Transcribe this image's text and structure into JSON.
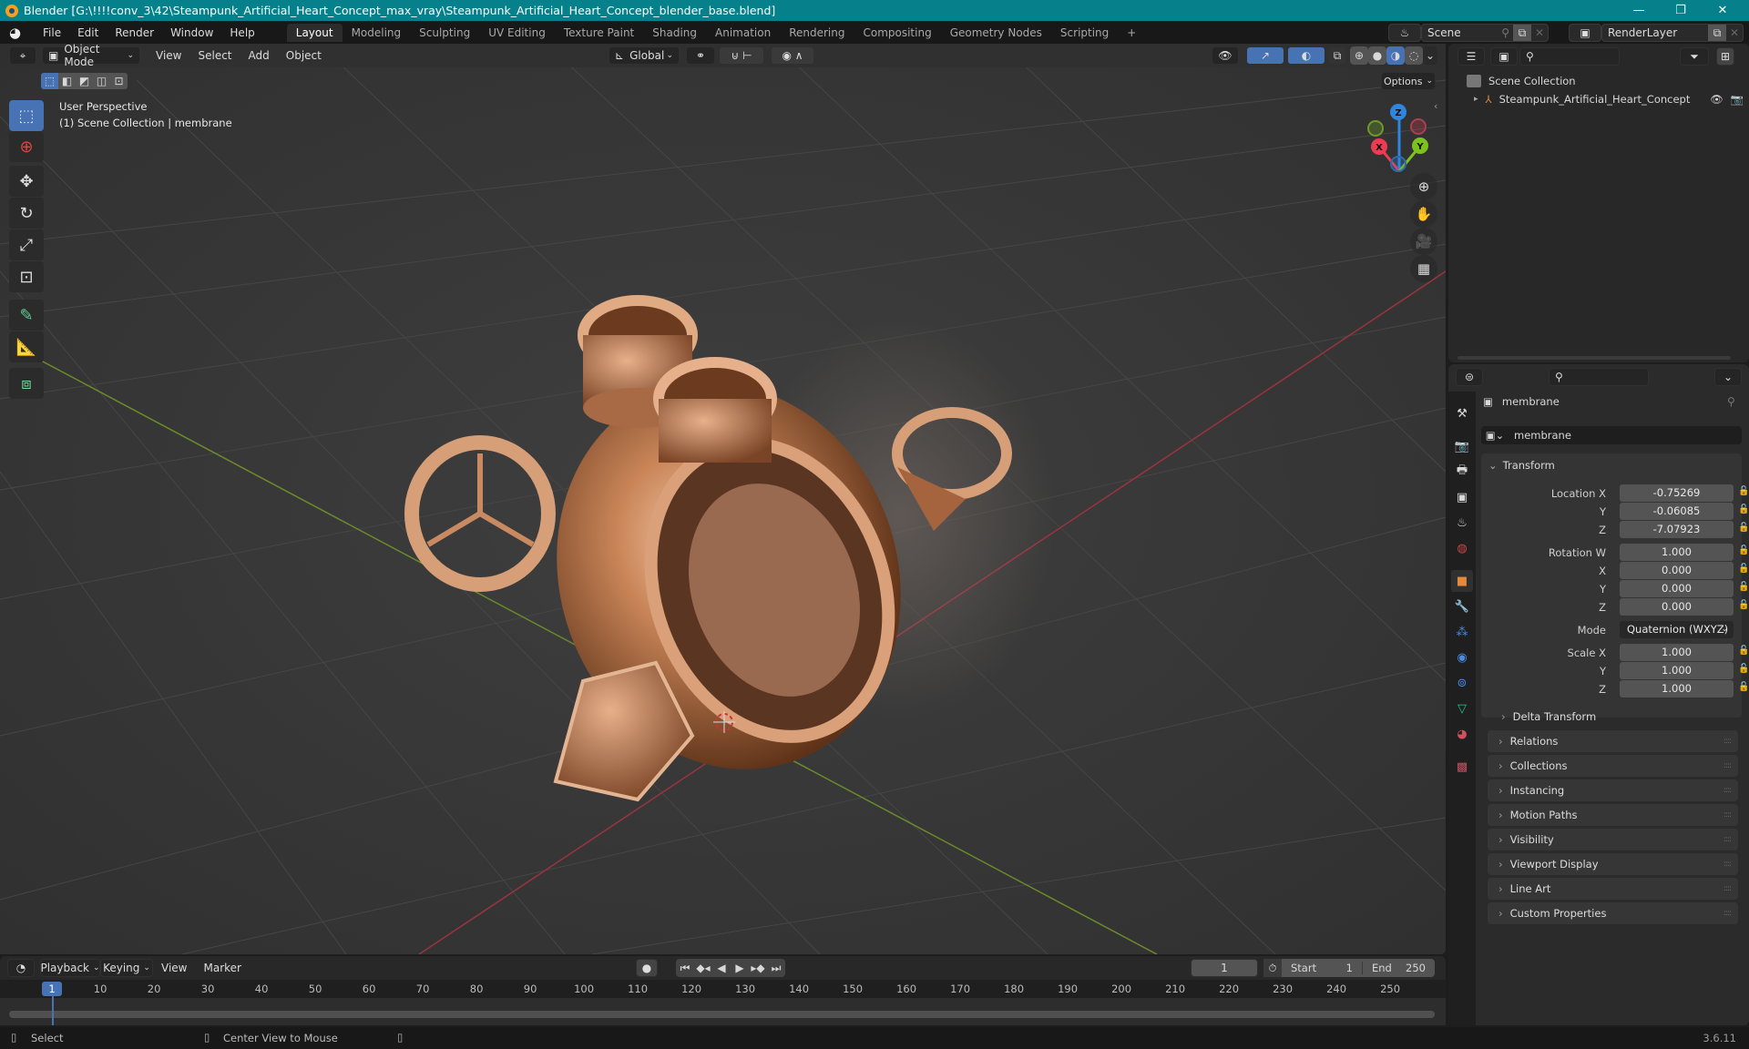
{
  "titlebar": {
    "title": "Blender [G:\\!!!!conv_3\\42\\Steampunk_Artificial_Heart_Concept_max_vray\\Steampunk_Artificial_Heart_Concept_blender_base.blend]",
    "minimize": "—",
    "maximize": "❐",
    "close": "✕"
  },
  "menubar": {
    "menus": [
      "File",
      "Edit",
      "Render",
      "Window",
      "Help"
    ],
    "workspaces": [
      "Layout",
      "Modeling",
      "Sculpting",
      "UV Editing",
      "Texture Paint",
      "Shading",
      "Animation",
      "Rendering",
      "Compositing",
      "Geometry Nodes",
      "Scripting"
    ],
    "active_workspace": "Layout",
    "add_workspace": "+",
    "scene": "Scene",
    "view_layer": "RenderLayer"
  },
  "viewport": {
    "mode": "Object Mode",
    "menus": [
      "View",
      "Select",
      "Add",
      "Object"
    ],
    "transform_orientation": "Global",
    "options_label": "Options",
    "overlay_text_line1": "User Perspective",
    "overlay_text_line2": "(1) Scene Collection | membrane",
    "gizmo_axes": {
      "x": "X",
      "y": "Y",
      "z": "Z"
    },
    "axis_colors": {
      "x": "#ee3a52",
      "y": "#7cc21f",
      "z": "#2f86e0"
    },
    "tools": [
      "select-box",
      "cursor",
      "move",
      "rotate",
      "scale",
      "transform",
      "annotate",
      "measure",
      "add-cube"
    ],
    "active_tool": "select-box"
  },
  "outliner": {
    "root": "Scene Collection",
    "items": [
      {
        "name": "Steampunk_Artificial_Heart_Concept",
        "type": "empty"
      }
    ]
  },
  "properties": {
    "object_name": "membrane",
    "data_name": "membrane",
    "transform_label": "Transform",
    "location": {
      "label": "Location X",
      "x": "-0.75269",
      "y": "-0.06085",
      "z": "-7.07923"
    },
    "rotation": {
      "label": "Rotation W",
      "w": "1.000",
      "x": "0.000",
      "y": "0.000",
      "z": "0.000"
    },
    "mode_label": "Mode",
    "mode_value": "Quaternion (WXYZ)",
    "scale": {
      "label": "Scale X",
      "x": "1.000",
      "y": "1.000",
      "z": "1.000"
    },
    "axis_labels": {
      "x": "X",
      "y": "Y",
      "z": "Z"
    },
    "delta_transform": "Delta Transform",
    "panels": [
      "Relations",
      "Collections",
      "Instancing",
      "Motion Paths",
      "Visibility",
      "Viewport Display",
      "Line Art",
      "Custom Properties"
    ]
  },
  "timeline": {
    "menus": [
      "Playback",
      "Keying",
      "View",
      "Marker"
    ],
    "current_frame": "1",
    "start_label": "Start",
    "start": "1",
    "end_label": "End",
    "end": "250",
    "ticks": [
      "1",
      "10",
      "20",
      "30",
      "40",
      "50",
      "60",
      "70",
      "80",
      "90",
      "100",
      "110",
      "120",
      "130",
      "140",
      "150",
      "160",
      "170",
      "180",
      "190",
      "200",
      "210",
      "220",
      "230",
      "240",
      "250"
    ]
  },
  "statusbar": {
    "left_action": "Select",
    "middle_action": "Center View to Mouse",
    "version": "3.6.11"
  }
}
